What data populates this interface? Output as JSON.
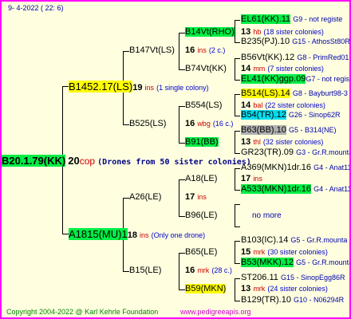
{
  "header": {
    "date": "9-  4-2022 ( 22:  6)"
  },
  "root": {
    "name": "B20.1.79(KK)",
    "num": "20",
    "breeder": "cop",
    "note": "(Drones from 50 sister colonies)"
  },
  "g1": [
    {
      "name": "B1452.17(LS)",
      "num": "19",
      "breeder": "ins",
      "note": "(1 single colony)"
    },
    {
      "name": "A1815(MU)1",
      "num": "18",
      "breeder": "ins",
      "note": "(Only one drone)"
    }
  ],
  "g2": [
    {
      "name": "B147Vt(LS)",
      "num": "16",
      "breeder": "ins",
      "note": "(2 c.)"
    },
    {
      "name": "B525(LS)",
      "num": "16",
      "breeder": "wbg",
      "note": "(16 c.)"
    },
    {
      "name": "A26(LE)",
      "num": "17",
      "breeder": "ins",
      "note": ""
    },
    {
      "name": "B15(LE)",
      "num": "16",
      "breeder": "mrk",
      "note": "(28 c.)"
    }
  ],
  "g3": [
    "B14Vt(RHO)",
    "B74Vt(KK)",
    "B554(LS)",
    "B91(BB)",
    "A18(LE)",
    "B96(LE)",
    "B65(LE)",
    "B59(MKN)"
  ],
  "g3i": [
    {
      "num": "13",
      "breeder": "hb",
      "note": "(18 sister colonies)"
    },
    {
      "num": "14",
      "breeder": "mm",
      "note": "(7 sister colonies)"
    },
    {
      "num": "14",
      "breeder": "bal",
      "note": "(22 sister colonies)"
    },
    {
      "num": "13",
      "breeder": "thl",
      "note": "(32 sister colonies)"
    },
    {
      "num": "17",
      "breeder": "ins",
      "note": ""
    },
    {
      "num": "",
      "breeder": "",
      "note": ""
    },
    {
      "num": "15",
      "breeder": "mrk",
      "note": "(30 sister colonies)"
    },
    {
      "num": "13",
      "breeder": "mrk",
      "note": "(24 sister colonies)"
    }
  ],
  "g4": [
    {
      "name": "EL61(KK).11",
      "info": "G9 - not registe"
    },
    {
      "name": "B235(PJ).10",
      "info": "G15 - AthosSt80R"
    },
    {
      "name": "B56Vt(KK).12",
      "info": "G8 - PrimRed01"
    },
    {
      "name": "EL41(KK)ggp.09",
      "info": "G7 - not registe"
    },
    {
      "name": "B514(LS).14",
      "info": "G8 - Bayburt98-3"
    },
    {
      "name": "B54(TR).12",
      "info": "G26 - Sinop62R"
    },
    {
      "name": "B63(BB).10",
      "info": "G5 - B314(NE)"
    },
    {
      "name": "GR23(TR).09",
      "info": "G3 - Gr.R.mounta"
    },
    {
      "name": "A369(MKN)1dr.16",
      "info": "G4 - Anat11Q"
    },
    {
      "name": "A533(MKN)1dr.16",
      "info": "G4 - Anat11Q"
    },
    {
      "name": "",
      "info": ""
    },
    {
      "name": "",
      "info": ""
    },
    {
      "name": "B103(IC).14",
      "info": "G5 - Gr.R.mounta"
    },
    {
      "name": "B53(MKK).12",
      "info": "G5 - Gr.R.mounta"
    },
    {
      "name": "ST206.11",
      "info": "G15 - SinopEgg86R"
    },
    {
      "name": "B129(TR).10",
      "info": "G10 - N06294R"
    }
  ],
  "unknown_label": "no more",
  "footer": {
    "copyright": "Copyright 2004-2022 @ Karl Kehrle Foundation",
    "url": "www.pedigreeapis.org"
  }
}
